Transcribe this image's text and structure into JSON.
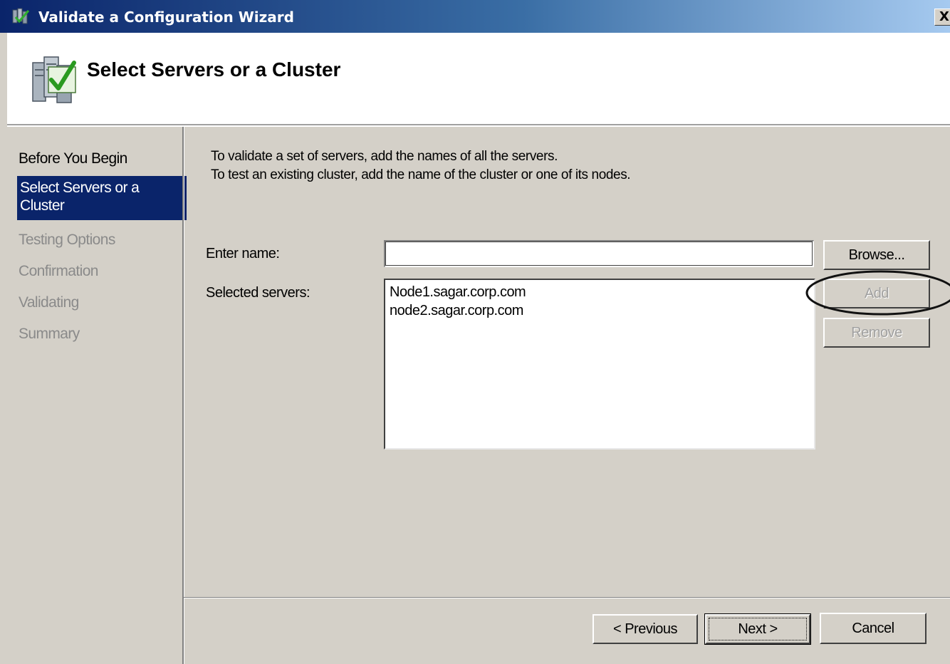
{
  "window": {
    "title": "Validate a Configuration Wizard",
    "close_glyph": "X",
    "icon": "cluster-validate-icon"
  },
  "header": {
    "title": "Select Servers or a Cluster",
    "icon": "servers-checkmark-icon"
  },
  "nav": {
    "items": [
      {
        "label": "Before You Begin",
        "state": "enabled"
      },
      {
        "label": "Select Servers or a Cluster",
        "state": "selected"
      },
      {
        "label": "Testing Options",
        "state": "disabled"
      },
      {
        "label": "Confirmation",
        "state": "disabled"
      },
      {
        "label": "Validating",
        "state": "disabled"
      },
      {
        "label": "Summary",
        "state": "disabled"
      }
    ]
  },
  "content": {
    "instruction_line1": "To validate a set of servers, add the names of all the servers.",
    "instruction_line2": "To test an existing cluster, add the name of the cluster or one of its nodes.",
    "enter_name_label": "Enter name:",
    "enter_name_value": "",
    "selected_servers_label": "Selected servers:",
    "selected_servers": [
      "Node1.sagar.corp.com",
      "node2.sagar.corp.com"
    ],
    "browse_label": "Browse...",
    "add_label": "Add",
    "remove_label": "Remove"
  },
  "footer": {
    "previous_label": "< Previous",
    "next_label": "Next >",
    "cancel_label": "Cancel"
  },
  "colors": {
    "selection": "#0a246a",
    "face": "#d4d0c8",
    "disabled_text": "#8a8a8a"
  }
}
